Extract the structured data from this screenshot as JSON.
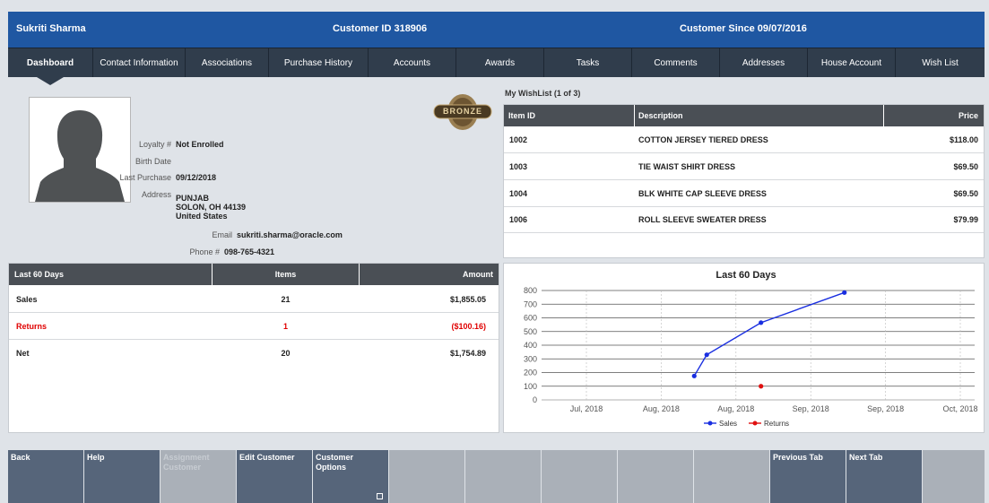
{
  "header": {
    "customer_name": "Sukriti Sharma",
    "customer_id": "Customer ID 318906",
    "customer_since": "Customer Since 09/07/2016"
  },
  "tabs": [
    {
      "label": "Dashboard",
      "active": true
    },
    {
      "label": "Contact Information"
    },
    {
      "label": "Associations"
    },
    {
      "label": "Purchase History"
    },
    {
      "label": "Accounts"
    },
    {
      "label": "Awards"
    },
    {
      "label": "Tasks"
    },
    {
      "label": "Comments"
    },
    {
      "label": "Addresses"
    },
    {
      "label": "House Account"
    },
    {
      "label": "Wish List"
    }
  ],
  "profile": {
    "tier_badge": "BRONZE",
    "loyalty_label": "Loyalty #",
    "loyalty_value": "Not Enrolled",
    "birth_date_label": "Birth Date",
    "birth_date_value": "",
    "last_purchase_label": "Last Purchase",
    "last_purchase_value": "09/12/2018",
    "address_label": "Address",
    "address_line1": "PUNJAB",
    "address_line2": "SOLON, OH 44139",
    "address_line3": "United States",
    "email_label": "Email",
    "email_value": "sukriti.sharma@oracle.com",
    "phone_label": "Phone #",
    "phone_value": "098-765-4321"
  },
  "wishlist": {
    "title": "My WishList (1 of 3)",
    "columns": {
      "item_id": "Item ID",
      "description": "Description",
      "price": "Price"
    },
    "rows": [
      {
        "item_id": "1002",
        "description": "COTTON JERSEY TIERED DRESS",
        "price": "$118.00"
      },
      {
        "item_id": "1003",
        "description": "TIE WAIST SHIRT DRESS",
        "price": "$69.50"
      },
      {
        "item_id": "1004",
        "description": "BLK WHITE CAP SLEEVE DRESS",
        "price": "$69.50"
      },
      {
        "item_id": "1006",
        "description": "ROLL SLEEVE SWEATER DRESS",
        "price": "$79.99"
      }
    ]
  },
  "summary": {
    "columns": {
      "period": "Last 60 Days",
      "items": "Items",
      "amount": "Amount"
    },
    "rows": [
      {
        "label": "Sales",
        "items": "21",
        "amount": "$1,855.05",
        "negative": false
      },
      {
        "label": "Returns",
        "items": "1",
        "amount": "($100.16)",
        "negative": true
      },
      {
        "label": "Net",
        "items": "20",
        "amount": "$1,754.89",
        "negative": false
      }
    ]
  },
  "chart_data": {
    "type": "line",
    "title": "Last 60 Days",
    "y_ticks": [
      "0",
      "100",
      "200",
      "300",
      "400",
      "500",
      "600",
      "700",
      "800"
    ],
    "ylim": [
      0,
      800
    ],
    "x_ticks": [
      "Jul, 2018",
      "Aug, 2018",
      "Aug, 2018",
      "Sep, 2018",
      "Sep, 2018",
      "Oct, 2018"
    ],
    "grid": true,
    "legend_position": "bottom",
    "series": [
      {
        "name": "Sales",
        "color": "#1a2fe0",
        "points": [
          {
            "x": "2018-07-29",
            "y": 175
          },
          {
            "x": "2018-08-01",
            "y": 330
          },
          {
            "x": "2018-08-14",
            "y": 565
          },
          {
            "x": "2018-09-03",
            "y": 785
          }
        ]
      },
      {
        "name": "Returns",
        "color": "#e01010",
        "points": [
          {
            "x": "2018-08-14",
            "y": 100
          }
        ]
      }
    ]
  },
  "actions": [
    {
      "label": "Back",
      "enabled": true
    },
    {
      "label": "Help",
      "enabled": true
    },
    {
      "label": "Assignment Customer",
      "enabled": false
    },
    {
      "label": "Edit Customer",
      "enabled": true
    },
    {
      "label": "Customer Options",
      "enabled": true,
      "menu": true
    },
    {
      "label": "",
      "blank": true
    },
    {
      "label": "",
      "blank": true
    },
    {
      "label": "",
      "blank": true
    },
    {
      "label": "",
      "blank": true
    },
    {
      "label": "",
      "blank": true
    },
    {
      "label": "Previous Tab",
      "enabled": true
    },
    {
      "label": "Next Tab",
      "enabled": true
    },
    {
      "label": "",
      "blank": true
    }
  ]
}
